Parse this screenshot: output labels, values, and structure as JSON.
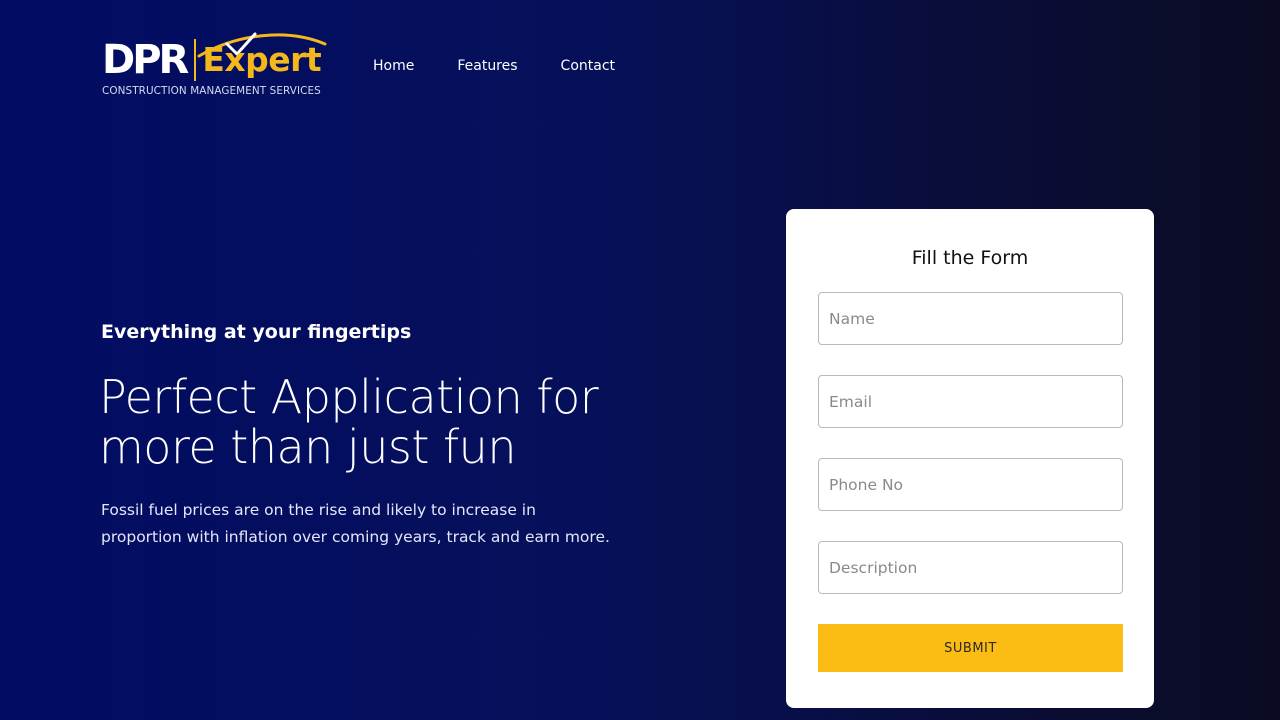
{
  "brand": {
    "logo_primary": "DPR",
    "logo_secondary": "Expert",
    "tagline": "CONSTRUCTION MANAGEMENT SERVICES",
    "accent_color": "#f5b81c"
  },
  "nav": {
    "items": [
      {
        "label": "Home"
      },
      {
        "label": "Features"
      },
      {
        "label": "Contact"
      }
    ]
  },
  "hero": {
    "eyebrow": "Everything at your fingertips",
    "headline_line1": "Perfect Application for",
    "headline_line2": "more than just fun",
    "subtext": "Fossil fuel prices are on the rise and likely to increase in proportion with inflation over coming years, track and earn more."
  },
  "form": {
    "title": "Fill the Form",
    "name_placeholder": "Name",
    "email_placeholder": "Email",
    "phone_placeholder": "Phone No",
    "description_placeholder": "Description",
    "submit_label": "SUBMIT",
    "submit_color": "#fbbd14"
  }
}
